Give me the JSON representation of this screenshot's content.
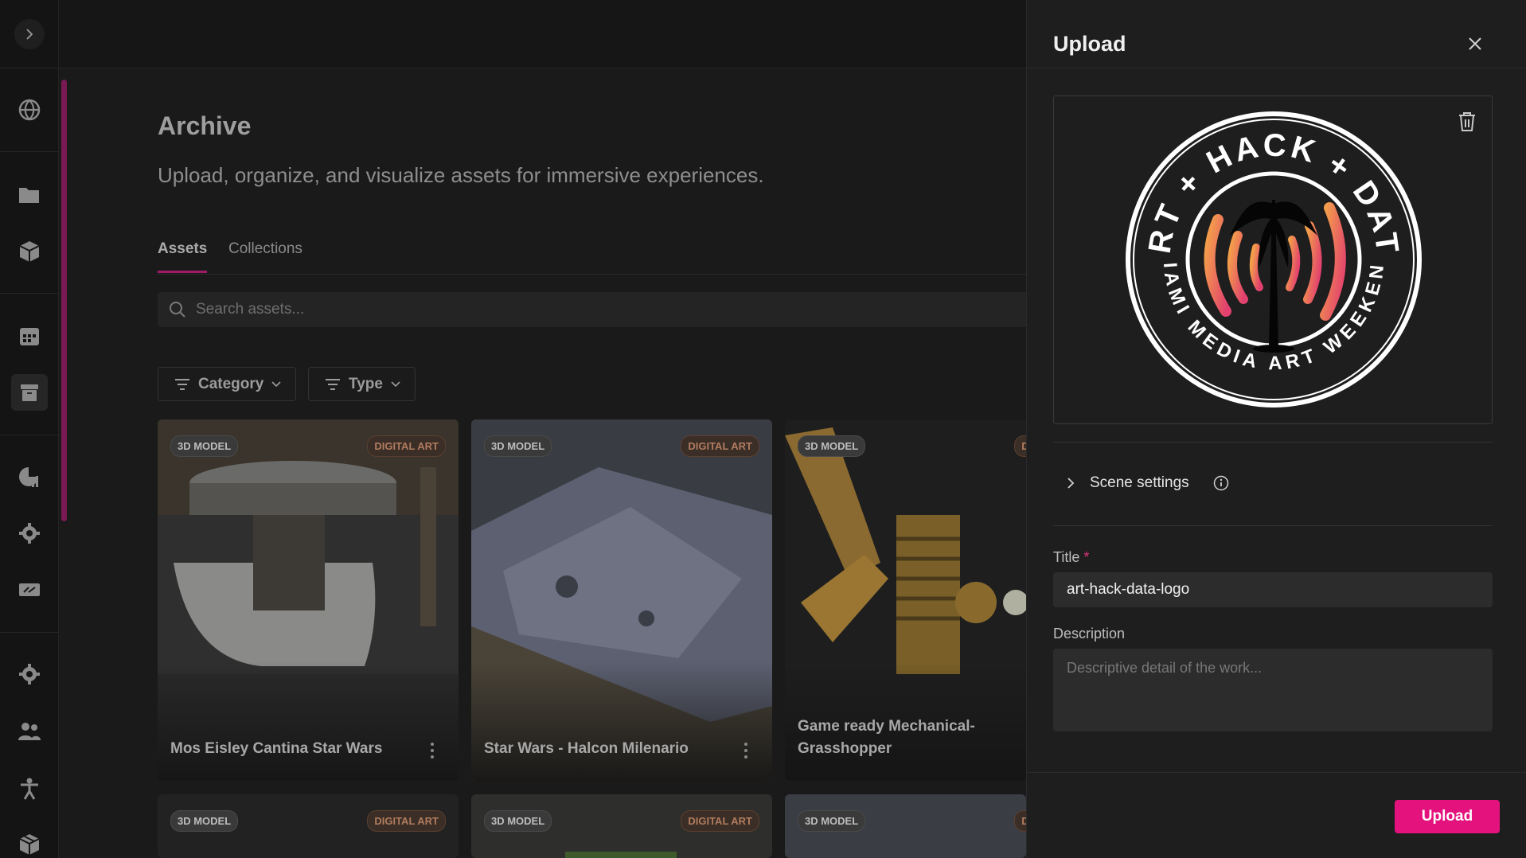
{
  "page": {
    "title": "Archive",
    "subtitle": "Upload, organize, and visualize assets for immersive experiences."
  },
  "tabs": [
    {
      "label": "Assets",
      "active": true
    },
    {
      "label": "Collections",
      "active": false
    }
  ],
  "search": {
    "placeholder": "Search assets..."
  },
  "filters": {
    "category_label": "Category",
    "type_label": "Type"
  },
  "cards": [
    {
      "type_badge": "3D MODEL",
      "category_badge": "DIGITAL ART",
      "name": "Mos Eisley Cantina Star Wars"
    },
    {
      "type_badge": "3D MODEL",
      "category_badge": "DIGITAL ART",
      "name": "Star Wars - Halcon Milenario"
    },
    {
      "type_badge": "3D MODEL",
      "category_badge": "DIGI",
      "name": "Game ready Mechanical-Grasshopper"
    },
    {
      "type_badge": "3D MODEL",
      "category_badge": "DIGITAL ART",
      "name": ""
    },
    {
      "type_badge": "3D MODEL",
      "category_badge": "DIGITAL ART",
      "name": ""
    },
    {
      "type_badge": "3D MODEL",
      "category_badge": "DIGI",
      "name": ""
    }
  ],
  "sidebar": {
    "icons": [
      "globe-icon",
      "folder-icon",
      "cube-icon",
      "calendar-icon",
      "archive-icon",
      "chart-icon",
      "settings-icon",
      "ticket-icon",
      "gear-icon",
      "users-icon",
      "accessibility-icon",
      "box-icon"
    ]
  },
  "upload_panel": {
    "title": "Upload",
    "preview_logo": {
      "top_text": "ART + HACK + DATA",
      "bottom_text": "MIAMI MEDIA ART WEEKEND"
    },
    "scene_settings_label": "Scene settings",
    "title_label": "Title",
    "required_mark": "*",
    "title_value": "art-hack-data-logo",
    "description_label": "Description",
    "description_placeholder": "Descriptive detail of the work...",
    "upload_button": "Upload"
  },
  "colors": {
    "accent": "#e3127c",
    "tab_underline": "#a01a68",
    "background": "#1a1a1a",
    "panel": "#1e1e1e"
  }
}
